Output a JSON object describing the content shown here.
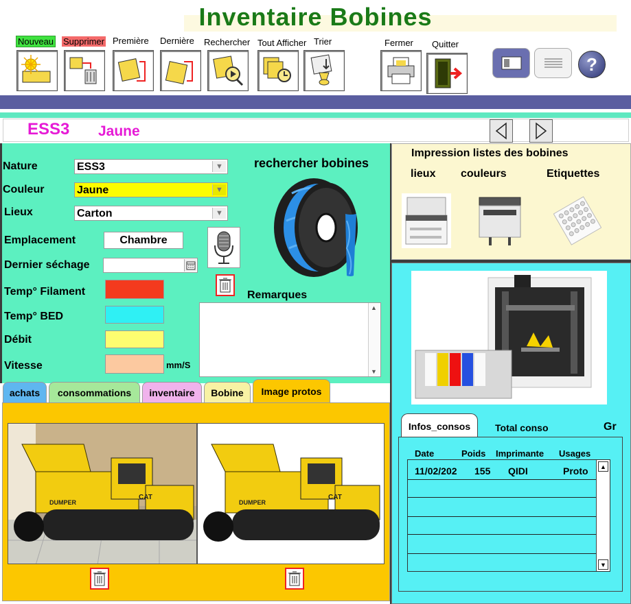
{
  "app": {
    "title": "Inventaire Bobines"
  },
  "toolbar": {
    "nouveau": "Nouveau",
    "supprimer": "Supprimer",
    "premiere": "Première",
    "derniere": "Dernière",
    "rechercher": "Rechercher",
    "tout_afficher": "Tout Afficher",
    "trier": "Trier",
    "fermer": "Fermer",
    "quitter": "Quitter"
  },
  "record": {
    "nature": "ESS3",
    "couleur": "Jaune"
  },
  "form": {
    "nature_label": "Nature",
    "nature_value": "ESS3",
    "couleur_label": "Couleur",
    "couleur_value": "Jaune",
    "lieux_label": "Lieux",
    "lieux_value": "Carton",
    "emplacement_label": "Emplacement",
    "emplacement_value": "Chambre",
    "dernier_sechage_label": "Dernier séchage",
    "dernier_sechage_value": "",
    "temp_filament_label": "Temp° Filament",
    "temp_bed_label": "Temp°  BED",
    "debit_label": "Débit",
    "vitesse_label": "Vitesse",
    "vitesse_unit": "mm/S",
    "remarques_label": "Remarques",
    "remarques_value": "",
    "rechercher_bobines": "rechercher bobines"
  },
  "colors": {
    "temp_filament": "#f43a1e",
    "temp_bed": "#2ff0f4",
    "debit": "#fdfd70",
    "vitesse": "#fcc9a0",
    "couleur_field": "#fdfd00"
  },
  "tabs": [
    {
      "label": "achats",
      "color": "#5fb6f0"
    },
    {
      "label": "consommations",
      "color": "#a6e89a"
    },
    {
      "label": "inventaire",
      "color": "#f0b2ec"
    },
    {
      "label": "Bobine",
      "color": "#f8f2a4"
    },
    {
      "label": "Image protos",
      "color": "#fcc700",
      "active": true
    }
  ],
  "print_section": {
    "title": "Impression listes des bobines",
    "lieux": "lieux",
    "couleurs": "couleurs",
    "etiquettes": "Etiquettes"
  },
  "conso": {
    "tab_infos": "Infos_consos",
    "tab_total": "Total conso",
    "gr_label": "Gr",
    "headers": [
      "Date",
      "Poids",
      "Imprimante",
      "Usages"
    ],
    "rows": [
      {
        "date": "11/02/202",
        "poids": "155",
        "imprimante": "QIDI",
        "usages": "Proto"
      }
    ]
  },
  "icons": {
    "nouveau": "new-record-icon",
    "supprimer": "delete-record-icon",
    "premiere": "first-record-icon",
    "derniere": "last-record-icon",
    "rechercher": "search-record-icon",
    "tout_afficher": "show-all-icon",
    "trier": "sort-icon",
    "fermer": "close-printer-icon",
    "quitter": "quit-door-icon"
  }
}
